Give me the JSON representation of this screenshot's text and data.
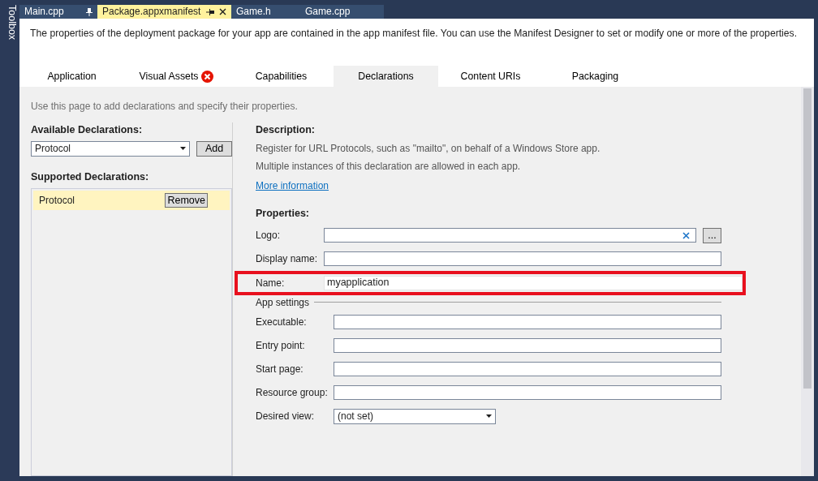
{
  "toolbox": {
    "label": "Toolbox"
  },
  "doc_tabs": [
    {
      "label": "Main.cpp",
      "selected": false,
      "pinned": true,
      "closable": false
    },
    {
      "label": "Package.appxmanifest",
      "selected": true,
      "pinned": false,
      "closable": true
    },
    {
      "label": "Game.h",
      "selected": false,
      "closable": false
    },
    {
      "label": "Game.cpp",
      "selected": false,
      "closable": false
    }
  ],
  "intro": "The properties of the deployment package for your app are contained in the app manifest file. You can use the Manifest Designer to set or modify one or more of the properties.",
  "tabs": [
    {
      "label": "Application",
      "selected": false,
      "error": false
    },
    {
      "label": "Visual Assets",
      "selected": false,
      "error": true
    },
    {
      "label": "Capabilities",
      "selected": false,
      "error": false
    },
    {
      "label": "Declarations",
      "selected": true,
      "error": false
    },
    {
      "label": "Content URIs",
      "selected": false,
      "error": false
    },
    {
      "label": "Packaging",
      "selected": false,
      "error": false
    }
  ],
  "page_hint": "Use this page to add declarations and specify their properties.",
  "available": {
    "label": "Available Declarations:",
    "value": "Protocol",
    "button": "Add"
  },
  "supported": {
    "label": "Supported Declarations:",
    "items": [
      {
        "label": "Protocol",
        "selected": true,
        "button": "Remove"
      }
    ]
  },
  "description": {
    "title": "Description:",
    "lines": [
      "Register for URL Protocols, such as \"mailto\", on behalf of a Windows Store app.",
      "Multiple instances of this declaration are allowed in each app."
    ],
    "link": "More information"
  },
  "properties": {
    "title": "Properties:",
    "fields": [
      {
        "kind": "clearable",
        "label": "Logo:",
        "browse": "...",
        "highlighted": false
      },
      {
        "kind": "text",
        "label": "Display name:",
        "highlighted": false
      },
      {
        "kind": "text",
        "label": "Name:",
        "value": "myapplication",
        "highlighted": true
      }
    ],
    "app_settings": {
      "title": "App settings",
      "fields": [
        {
          "kind": "text",
          "label": "Executable:"
        },
        {
          "kind": "text",
          "label": "Entry point:"
        },
        {
          "kind": "text",
          "label": "Start page:"
        },
        {
          "kind": "text",
          "label": "Resource group:"
        },
        {
          "kind": "select",
          "label": "Desired view:",
          "value": "(not set)"
        }
      ]
    }
  }
}
